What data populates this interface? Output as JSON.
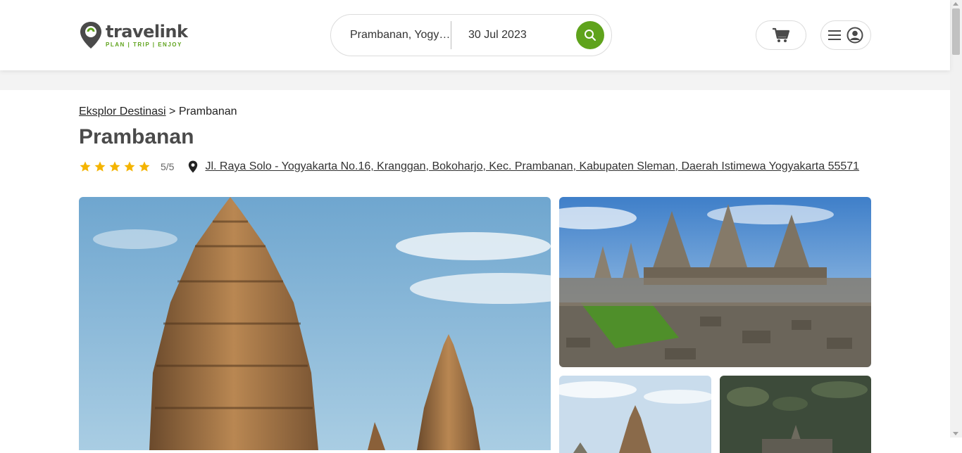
{
  "header": {
    "logo_word": "travelink",
    "logo_tagline": "PLAN | TRIP | ENJOY",
    "search": {
      "destination": "Prambanan, Yogyakarta",
      "date": "30 Jul 2023"
    },
    "icons": {
      "search": "search-icon",
      "cart": "cart-icon",
      "menu": "hamburger-menu-icon",
      "user": "user-circle-icon"
    }
  },
  "breadcrumb": {
    "parent": "Eksplor Destinasi",
    "separator": " > ",
    "current": "Prambanan"
  },
  "destination": {
    "title": "Prambanan",
    "rating_stars": 5,
    "rating_text": "5/5",
    "address": "Jl. Raya Solo - Yogyakarta No.16, Kranggan, Bokoharjo, Kec. Prambanan, Kabupaten Sleman, Daerah Istimewa Yogyakarta 55571"
  },
  "colors": {
    "brand_green": "#5fa31c",
    "star_yellow": "#f4b400",
    "title_gray": "#4a4a4a"
  }
}
